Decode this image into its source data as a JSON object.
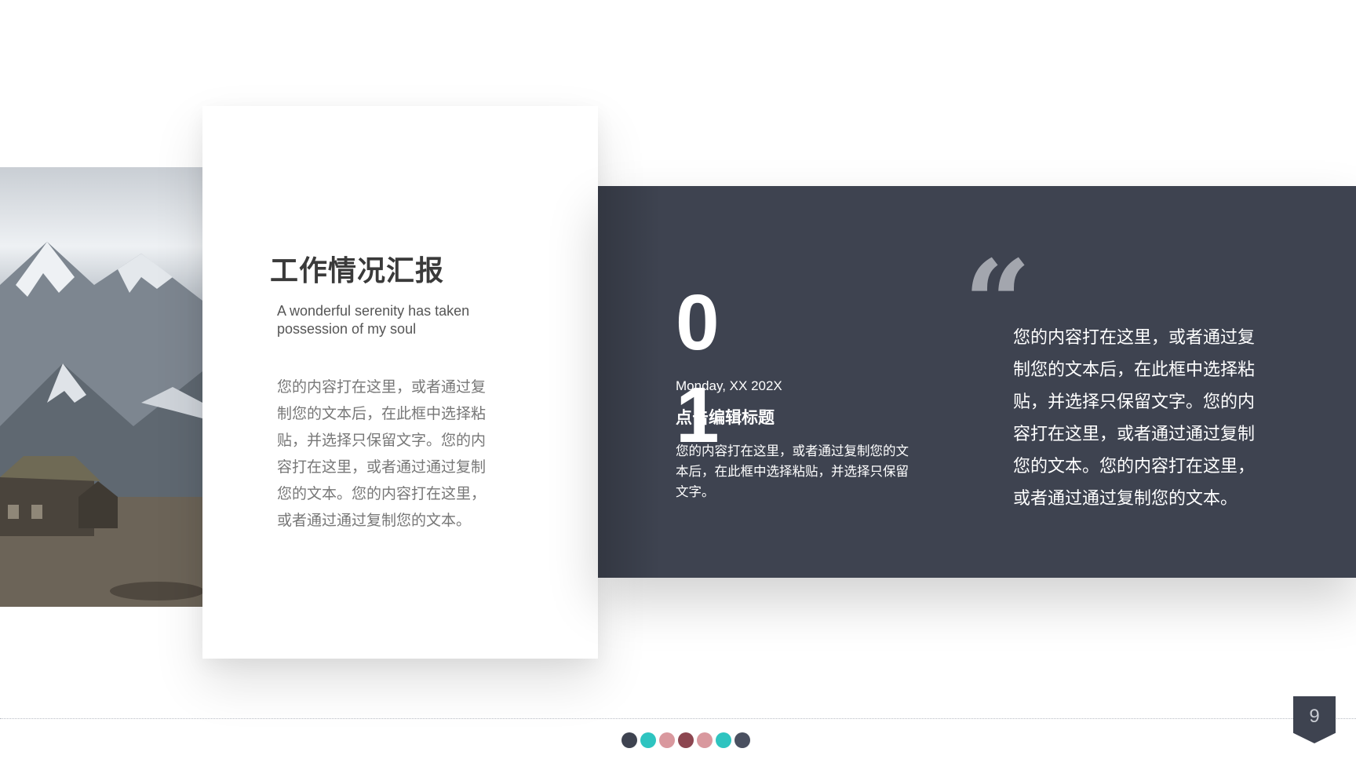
{
  "card": {
    "title": "工作情况汇报",
    "subtitle": "A wonderful serenity has taken possession of my soul",
    "body": "您的内容打在这里，或者通过复制您的文本后，在此框中选择粘贴，并选择只保留文字。您的内容打在这里，或者通过通过复制您的文本。您的内容打在这里，或者通过通过复制您的文本。"
  },
  "panel": {
    "number": "01",
    "date": "Monday, XX 202X",
    "heading": "点击编辑标题",
    "description": "您的内容打在这里，或者通过复制您的文本后，在此框中选择粘贴，并选择只保留文字。",
    "quote_mark": "“",
    "quote": "您的内容打在这里，或者通过复制您的文本后，在此框中选择粘贴，并选择只保留文字。您的内容打在这里，或者通过通过复制您的文本。您的内容打在这里，或者通过通过复制您的文本。"
  },
  "footer": {
    "page_number": "9",
    "dot_colors": [
      "#3e4350",
      "#2ec4c0",
      "#d9989e",
      "#8c4650",
      "#d9989e",
      "#2ec4c0",
      "#4a5060"
    ]
  },
  "colors": {
    "dark_panel": "#3e4350",
    "accent_teal": "#2ec4c0",
    "accent_pink": "#d9989e",
    "accent_maroon": "#8c4650"
  },
  "icons": {
    "photo": "mountain-cabin-photo",
    "quote": "quote-icon",
    "page_badge": "bookmark-badge-icon"
  }
}
